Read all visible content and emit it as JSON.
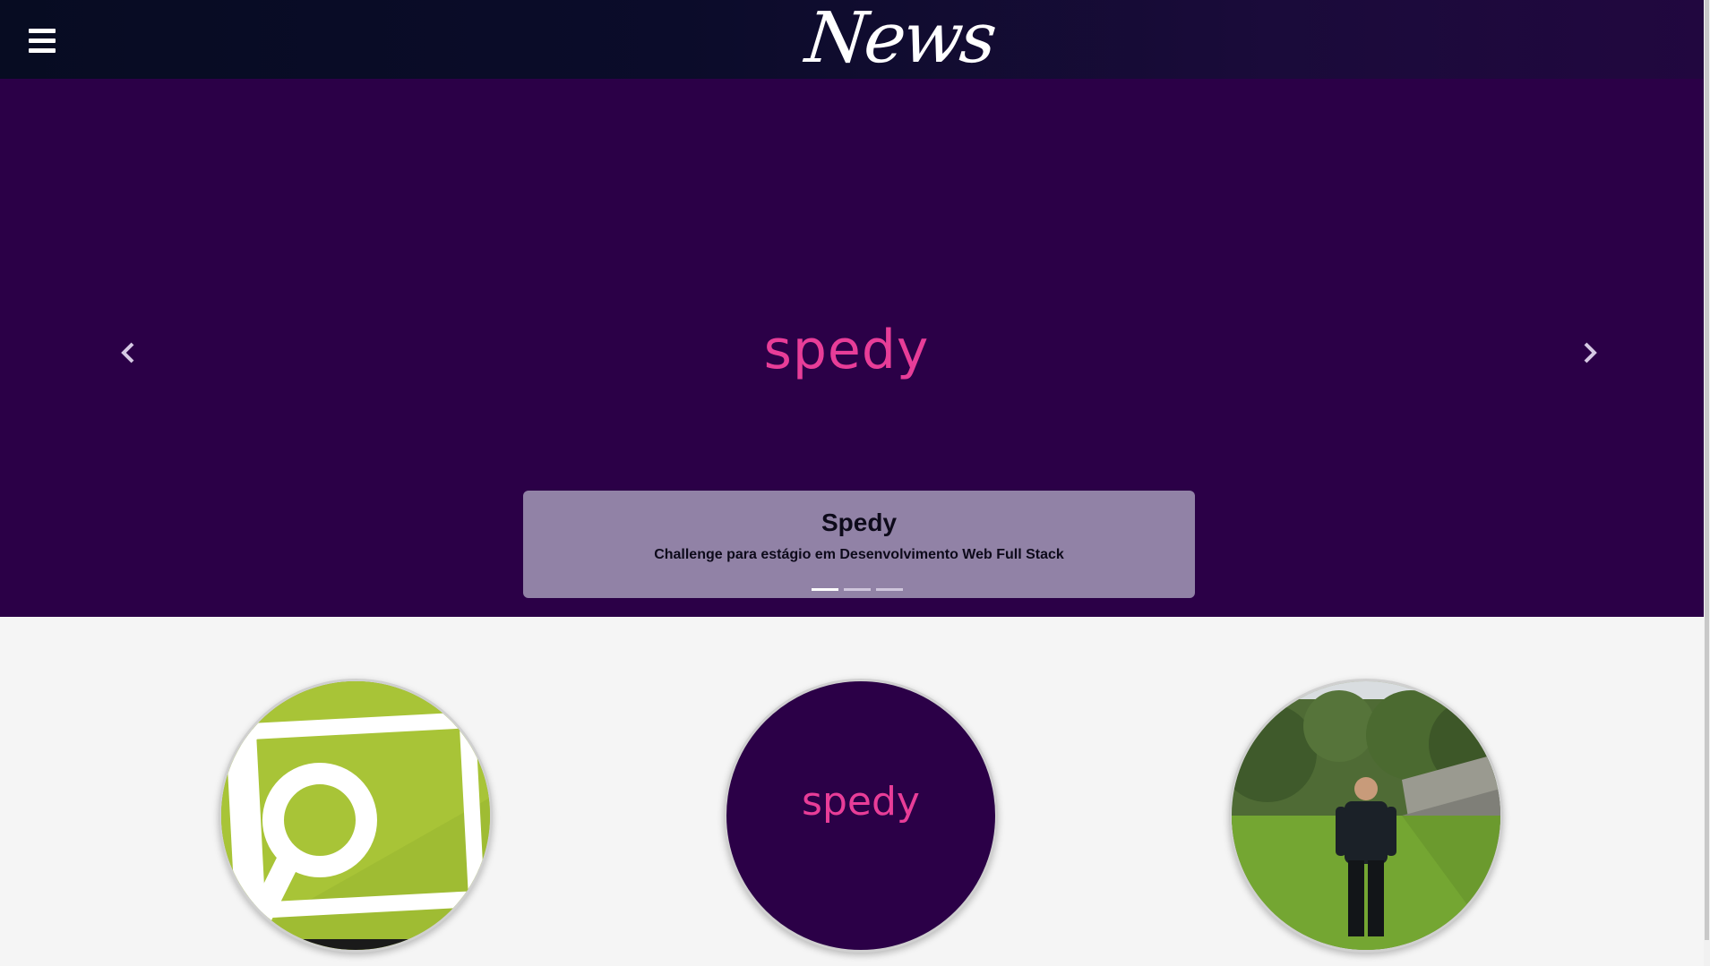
{
  "navbar": {
    "brand": "News",
    "menu_icon": "hamburger-menu-icon"
  },
  "carousel": {
    "slide_logo": "spedy",
    "prev_icon": "chevron-left-icon",
    "next_icon": "chevron-right-icon",
    "caption": {
      "title": "Spedy",
      "text": "Challenge para estágio em Desenvolvimento Web Full Stack"
    },
    "indicator_count": 3,
    "active_indicator": 1
  },
  "cards": [
    {
      "name": "search-app-icon-card",
      "icon": "magnifier-image-icon",
      "color": "#9fbc33"
    },
    {
      "name": "spedy-logo-card",
      "logo": "spedy",
      "color": "#2b0047"
    },
    {
      "name": "profile-photo-card",
      "icon": "person-photo",
      "color": "#6d8a3a"
    }
  ],
  "colors": {
    "navbar": "#070c22",
    "carousel_bg": "#2b0047",
    "spedy_pink": "#e83d98",
    "caption_bg": "#9182a6",
    "page_bg": "#f5f5f5"
  }
}
